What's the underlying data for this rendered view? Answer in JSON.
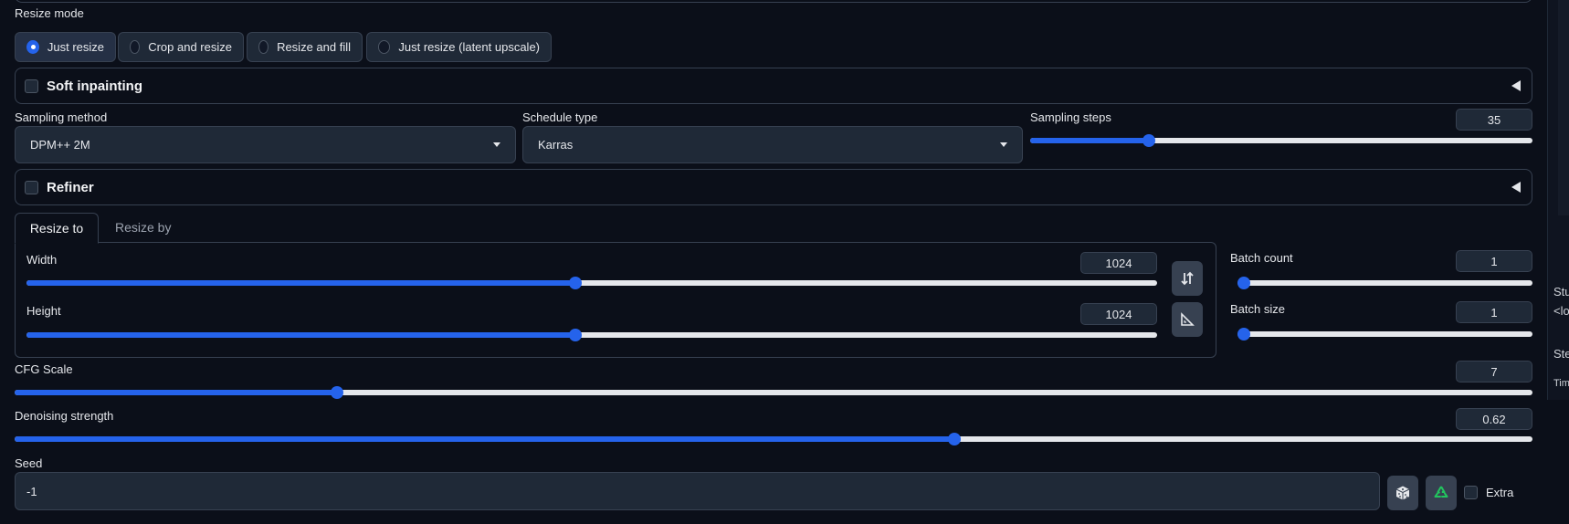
{
  "resize_mode": {
    "label": "Resize mode",
    "options": [
      "Just resize",
      "Crop and resize",
      "Resize and fill",
      "Just resize (latent upscale)"
    ],
    "selected": "Just resize"
  },
  "soft_inpainting": {
    "label": "Soft inpainting",
    "checked": false
  },
  "sampling_method": {
    "label": "Sampling method",
    "value": "DPM++ 2M"
  },
  "schedule_type": {
    "label": "Schedule type",
    "value": "Karras"
  },
  "sampling_steps": {
    "label": "Sampling steps",
    "value": "35",
    "fraction": 0.23
  },
  "refiner": {
    "label": "Refiner",
    "checked": false
  },
  "tabs": {
    "resize_to": "Resize to",
    "resize_by": "Resize by",
    "active": "Resize to"
  },
  "width": {
    "label": "Width",
    "value": "1024",
    "fraction": 0.485
  },
  "height": {
    "label": "Height",
    "value": "1024",
    "fraction": 0.485
  },
  "batch_count": {
    "label": "Batch count",
    "value": "1",
    "fraction": 0.0
  },
  "batch_size": {
    "label": "Batch size",
    "value": "1",
    "fraction": 0.0
  },
  "cfg_scale": {
    "label": "CFG Scale",
    "value": "7",
    "fraction": 0.21
  },
  "denoising_strength": {
    "label": "Denoising strength",
    "value": "0.62",
    "fraction": 0.62
  },
  "seed": {
    "label": "Seed",
    "value": "-1",
    "extra_label": "Extra",
    "extra_checked": false
  },
  "right_panel": {
    "line1": "Stu",
    "line2": "<lo",
    "line3": "Ste",
    "line4": "Tim"
  },
  "icons": {
    "swap": "swap-dimensions-icon",
    "aspect": "aspect-ratio-icon",
    "dice": "dice-icon",
    "recycle": "recycle-icon",
    "accordion": "triangle-left-icon",
    "dropdown": "chevron-down-icon"
  },
  "colors": {
    "accent": "#2563eb",
    "background": "#0b0f19",
    "surface": "#1f2937",
    "border": "#374151",
    "recycle": "#22c55e"
  }
}
